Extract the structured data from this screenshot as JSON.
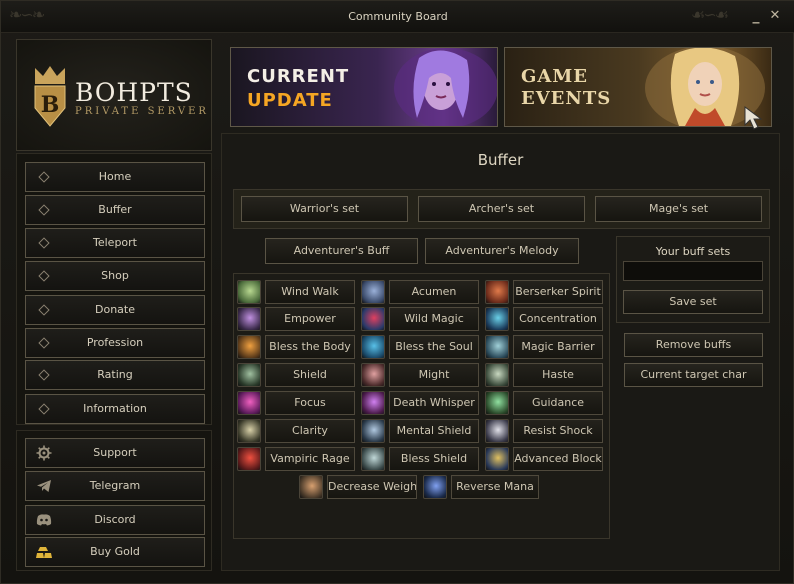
{
  "window": {
    "title": "Community Board"
  },
  "logo": {
    "title": "BOHPTS",
    "subtitle": "PRIVATE SERVER"
  },
  "nav": {
    "items": [
      {
        "label": "Home",
        "icon": "diamond-icon"
      },
      {
        "label": "Buffer",
        "icon": "diamond-icon"
      },
      {
        "label": "Teleport",
        "icon": "diamond-icon"
      },
      {
        "label": "Shop",
        "icon": "diamond-icon"
      },
      {
        "label": "Donate",
        "icon": "diamond-icon"
      },
      {
        "label": "Profession",
        "icon": "diamond-icon"
      },
      {
        "label": "Rating",
        "icon": "diamond-icon"
      },
      {
        "label": "Information",
        "icon": "diamond-icon"
      }
    ],
    "social": [
      {
        "label": "Support",
        "icon": "gear-icon"
      },
      {
        "label": "Telegram",
        "icon": "telegram-icon"
      },
      {
        "label": "Discord",
        "icon": "discord-icon"
      },
      {
        "label": "Buy Gold",
        "icon": "gold-bars-icon"
      }
    ]
  },
  "banners": {
    "update": {
      "line1": "CURRENT",
      "line2": "UPDATE"
    },
    "events": {
      "line1": "GAME",
      "line2": "EVENTS"
    }
  },
  "buffer": {
    "title": "Buffer",
    "sets": [
      "Warrior's set",
      "Archer's set",
      "Mage's set"
    ],
    "extras": [
      "Adventurer's Buff",
      "Adventurer's Melody"
    ],
    "skills": [
      "Wind Walk",
      "Acumen",
      "Berserker Spirit",
      "Empower",
      "Wild Magic",
      "Concentration",
      "Bless the Body",
      "Bless the Soul",
      "Magic Barrier",
      "Shield",
      "Might",
      "Haste",
      "Focus",
      "Death Whisper",
      "Guidance",
      "Clarity",
      "Mental Shield",
      "Resist Shock",
      "Vampiric Rage",
      "Bless Shield",
      "Advanced Block",
      "Decrease Weight",
      "Reverse Mana"
    ],
    "your_sets": {
      "title": "Your buff sets",
      "value": "",
      "save": "Save set"
    },
    "remove": "Remove buffs",
    "target": "Current target char"
  },
  "colors": {
    "accent_gold": "#b49b66",
    "update_orange": "#f5a623",
    "border": "#5a5445"
  }
}
